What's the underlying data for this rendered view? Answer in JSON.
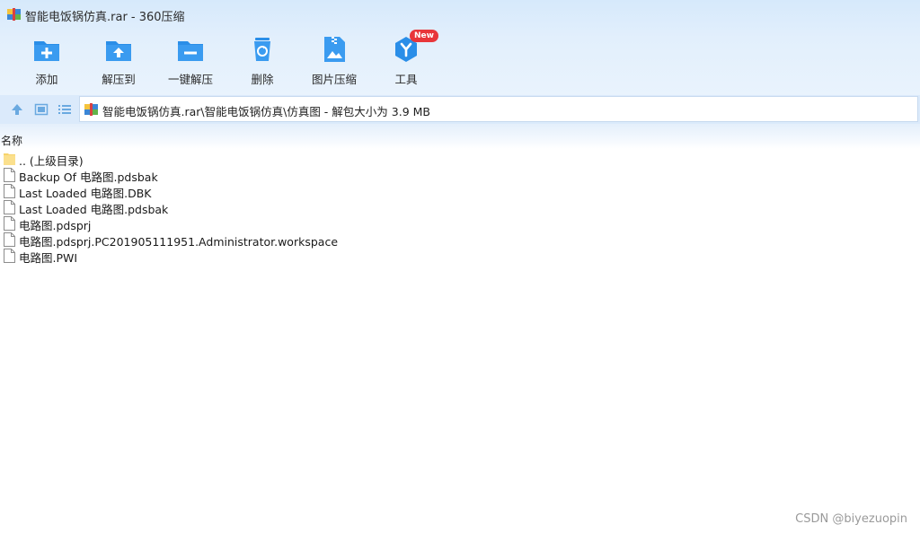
{
  "window": {
    "title": "智能电饭锅仿真.rar - 360压缩"
  },
  "toolbar": {
    "items": [
      {
        "label": "添加",
        "icon": "add-folder-icon"
      },
      {
        "label": "解压到",
        "icon": "extract-to-icon"
      },
      {
        "label": "一键解压",
        "icon": "one-click-extract-icon"
      },
      {
        "label": "删除",
        "icon": "recycle-bin-icon"
      },
      {
        "label": "图片压缩",
        "icon": "image-compress-icon"
      },
      {
        "label": "工具",
        "icon": "tools-icon",
        "badge": "New"
      }
    ]
  },
  "address": {
    "path": "智能电饭锅仿真.rar\\智能电饭锅仿真\\仿真图 - 解包大小为 3.9 MB"
  },
  "list": {
    "header": "名称",
    "items": [
      {
        "name": ".. (上级目录)",
        "type": "folder"
      },
      {
        "name": "Backup Of 电路图.pdsbak",
        "type": "file"
      },
      {
        "name": "Last Loaded 电路图.DBK",
        "type": "file"
      },
      {
        "name": "Last Loaded 电路图.pdsbak",
        "type": "file"
      },
      {
        "name": "电路图.pdsprj",
        "type": "file"
      },
      {
        "name": "电路图.pdsprj.PC201905111951.Administrator.workspace",
        "type": "file"
      },
      {
        "name": "电路图.PWI",
        "type": "file"
      }
    ]
  },
  "watermark": "CSDN @biyezuopin",
  "colors": {
    "accent": "#2a8ee8",
    "badge": "#e8363a",
    "folder": "#f7d36b"
  }
}
